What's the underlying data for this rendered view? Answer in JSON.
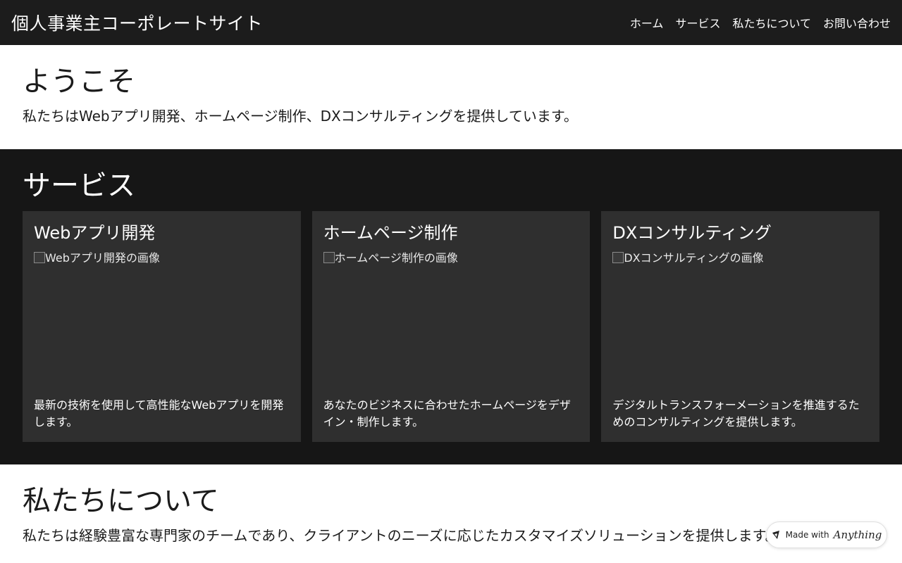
{
  "header": {
    "site_title": "個人事業主コーポレートサイト",
    "nav": [
      {
        "label": "ホーム"
      },
      {
        "label": "サービス"
      },
      {
        "label": "私たちについて"
      },
      {
        "label": "お問い合わせ"
      }
    ]
  },
  "welcome": {
    "heading": "ようこそ",
    "text": "私たちはWebアプリ開発、ホームページ制作、DXコンサルティングを提供しています。"
  },
  "services": {
    "heading": "サービス",
    "cards": [
      {
        "title": "Webアプリ開発",
        "image_alt": "Webアプリ開発の画像",
        "description": "最新の技術を使用して高性能なWebアプリを開発します。"
      },
      {
        "title": "ホームページ制作",
        "image_alt": "ホームページ制作の画像",
        "description": "あなたのビジネスに合わせたホームページをデザイン・制作します。"
      },
      {
        "title": "DXコンサルティング",
        "image_alt": "DXコンサルティングの画像",
        "description": "デジタルトランスフォーメーションを推進するためのコンサルティングを提供します。"
      }
    ]
  },
  "about": {
    "heading": "私たちについて",
    "text": "私たちは経験豊富な専門家のチームであり、クライアントのニーズに応じたカスタマイズソリューションを提供します。"
  },
  "badge": {
    "prefix": "Made with",
    "brand": "Anything"
  },
  "colors": {
    "header_bg": "#1c1c1c",
    "services_bg": "#161616",
    "card_bg": "#2f2f2f",
    "text_dark": "#1b1b1b",
    "text_light": "#ffffff"
  }
}
